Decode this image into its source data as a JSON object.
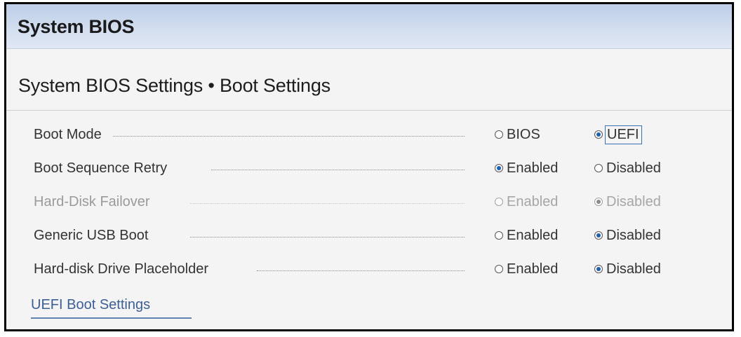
{
  "header": {
    "title": "System BIOS"
  },
  "page": {
    "title": "System BIOS Settings • Boot Settings"
  },
  "settings": [
    {
      "label": "Boot Mode",
      "enabled": true,
      "options": [
        {
          "label": "BIOS",
          "selected": false
        },
        {
          "label": "UEFI",
          "selected": true,
          "focused": true
        }
      ]
    },
    {
      "label": "Boot Sequence Retry",
      "enabled": true,
      "options": [
        {
          "label": "Enabled",
          "selected": true
        },
        {
          "label": "Disabled",
          "selected": false
        }
      ]
    },
    {
      "label": "Hard-Disk Failover",
      "enabled": false,
      "options": [
        {
          "label": "Enabled",
          "selected": false
        },
        {
          "label": "Disabled",
          "selected": true
        }
      ]
    },
    {
      "label": "Generic USB Boot",
      "enabled": true,
      "options": [
        {
          "label": "Enabled",
          "selected": false
        },
        {
          "label": "Disabled",
          "selected": true
        }
      ]
    },
    {
      "label": "Hard-disk Drive Placeholder",
      "enabled": true,
      "options": [
        {
          "label": "Enabled",
          "selected": false
        },
        {
          "label": "Disabled",
          "selected": true
        }
      ]
    }
  ],
  "links": {
    "uefi_boot_settings": "UEFI Boot Settings"
  },
  "colors": {
    "accent": "#1d5fb3",
    "link": "#3b5f94",
    "disabled_text": "#9a9a9a"
  }
}
